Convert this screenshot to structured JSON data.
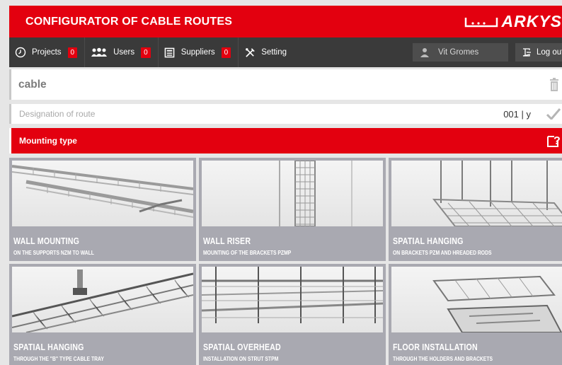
{
  "app": {
    "title": "CONFIGURATOR OF CABLE ROUTES",
    "logo_text": "ARKYS"
  },
  "nav": {
    "items": [
      {
        "label": "Projects",
        "icon": "clock-icon",
        "badge": "0"
      },
      {
        "label": "Users",
        "icon": "users-icon",
        "badge": "0"
      },
      {
        "label": "Suppliers",
        "icon": "suppliers-icon",
        "badge": "0"
      },
      {
        "label": "Setting",
        "icon": "tools-icon"
      }
    ],
    "user_name": "Vit Gromes",
    "logout_label": "Log out"
  },
  "form": {
    "cable_value": "cable",
    "route_label": "Designation of route",
    "route_code": "001 | y",
    "mounting_label": "Mounting type"
  },
  "tiles": [
    {
      "title": "WALL MOUNTING",
      "subtitle": "ON THE SUPPORTS NZM TO WALL"
    },
    {
      "title": "WALL RISER",
      "subtitle": "MOUNTING OF THE BRACKETS PZMP"
    },
    {
      "title": "SPATIAL HANGING",
      "subtitle": "ON BRACKETS PZM AND HREADED RODS"
    },
    {
      "title": "SPATIAL HANGING",
      "subtitle": "THROUGH THE \"B\" TYPE CABLE TRAY"
    },
    {
      "title": "SPATIAL OVERHEAD",
      "subtitle": "INSTALLATION ON STRUT STPM"
    },
    {
      "title": "FLOOR INSTALLATION",
      "subtitle": "THROUGH THE HOLDERS AND BRACKETS"
    }
  ],
  "colors": {
    "accent": "#e3000f",
    "nav_bg": "#3a3a3a",
    "tile_bg": "#a9a9b1"
  }
}
